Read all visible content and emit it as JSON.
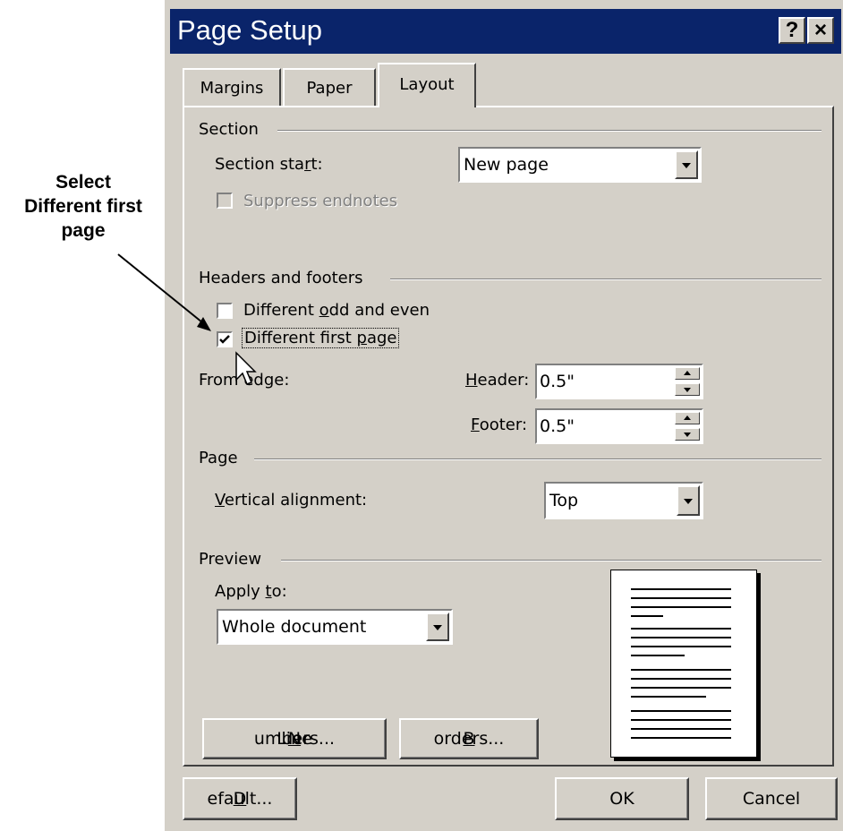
{
  "callout": {
    "line1": "Select",
    "line2": "Different first",
    "line3": "page"
  },
  "window": {
    "title": "Page Setup",
    "help_label": "?",
    "close_label": "×",
    "colors": {
      "titlebar": "#0a246a",
      "face": "#d4d0c8"
    }
  },
  "tabs": [
    {
      "label": "Margins"
    },
    {
      "label": "Paper"
    },
    {
      "label": "Layout",
      "active": true
    }
  ],
  "section": {
    "heading": "Section",
    "start_label_pre": "Section sta",
    "start_label_u": "r",
    "start_label_post": "t:",
    "start_value": "New page",
    "suppress_label": "Suppress endnotes",
    "suppress_checked": false,
    "suppress_enabled": false
  },
  "headers_footers": {
    "heading": "Headers and footers",
    "odd_even_pre": "Different ",
    "odd_even_u": "o",
    "odd_even_post": "dd and even",
    "odd_even_checked": false,
    "first_page_pre": "Different first ",
    "first_page_u": "p",
    "first_page_post": "age",
    "first_page_checked": true,
    "from_edge_label": "From edge:",
    "header_label_u": "H",
    "header_label_post": "eader:",
    "header_value": "0.5\"",
    "footer_label_u": "F",
    "footer_label_post": "ooter:",
    "footer_value": "0.5\""
  },
  "page": {
    "heading": "Page",
    "valign_label_u": "V",
    "valign_label_post": "ertical alignment:",
    "valign_value": "Top"
  },
  "preview": {
    "heading": "Preview",
    "apply_to_pre": "Apply ",
    "apply_to_u": "t",
    "apply_to_post": "o:",
    "apply_to_value": "Whole document",
    "line_numbers_pre": "Line ",
    "line_numbers_u": "N",
    "line_numbers_post": "umbers...",
    "borders_u": "B",
    "borders_post": "orders..."
  },
  "footer_buttons": {
    "default_u": "D",
    "default_post": "efault...",
    "ok": "OK",
    "cancel": "Cancel"
  }
}
